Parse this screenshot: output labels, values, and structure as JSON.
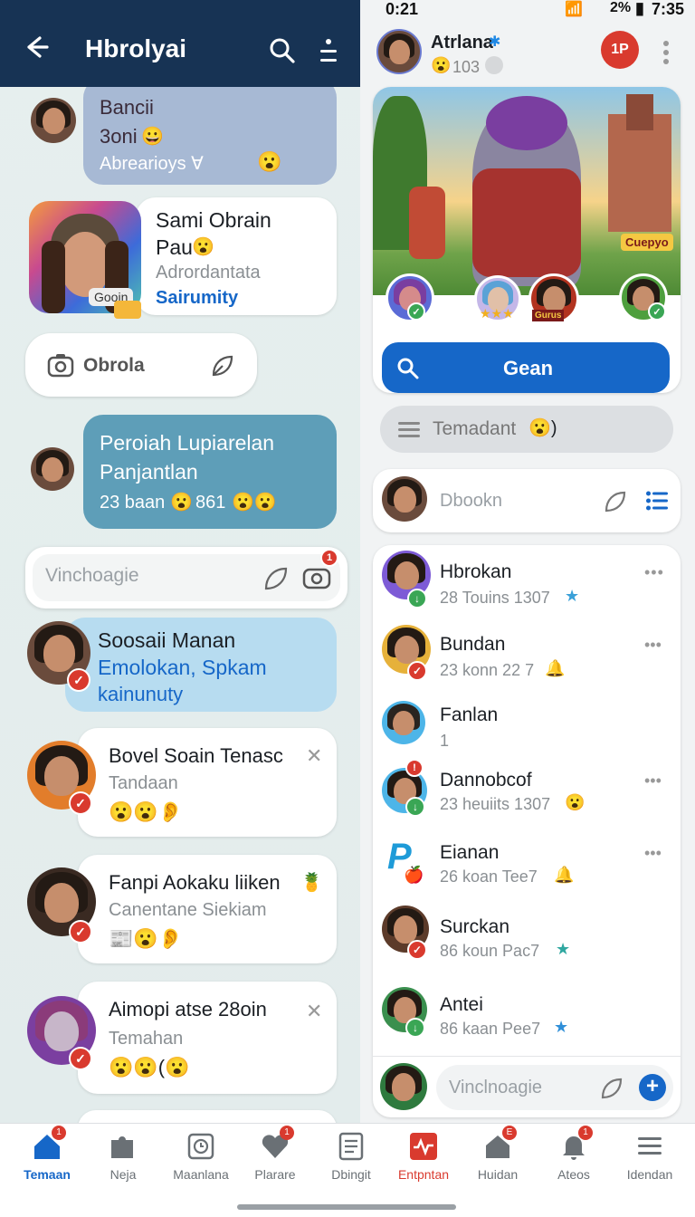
{
  "status_bar": {
    "left_time": "0:21",
    "battery": "2%",
    "right_time": "7:35"
  },
  "left_header": {
    "title": "Hbrolyai"
  },
  "left_chat": {
    "top_bubble": {
      "line1": "Bancii",
      "line2": "3oni",
      "sub": "Abrearioys ∀"
    },
    "profile_card": {
      "name": "Sami Obrain",
      "name2": "Pau",
      "sub": "Adrordantata",
      "link": "Sairumity",
      "badge": "Gooin"
    },
    "input_camera": {
      "label": "Obrola"
    },
    "message": {
      "line1": "Peroiah Lupiarelan",
      "line2": "Panjantlan",
      "stats": "23 baan",
      "stats2": "861"
    },
    "input_main": {
      "placeholder": "Vinchoagie",
      "badge": "1"
    },
    "highlight": {
      "title": "Soosaii Manan",
      "link1": "Emolokan, Spkam",
      "link2": "kainunuty"
    },
    "notifications": [
      {
        "title": "Bovel Soain Tenasc",
        "sub": "Tandaan"
      },
      {
        "title": "Fanpi Aokaku liiken",
        "sub": "Canentane Siekiam"
      },
      {
        "title": "Aimopi atse 28oin",
        "sub": "Temahan"
      }
    ]
  },
  "right_panel": {
    "profile": {
      "name": "Atrlana",
      "count": "103",
      "red_badge": "1P"
    },
    "banner_label": "Cuepyo",
    "mini_label": "Gurus",
    "primary_button": "Gean",
    "filter": {
      "label": "Temadant"
    },
    "search": {
      "label": "Dbookn"
    },
    "contacts": [
      {
        "name": "Hbrokan",
        "sub": "28 Touins 1307"
      },
      {
        "name": "Bundan",
        "sub": "23 konn 22  7"
      },
      {
        "name": "Fanlan",
        "sub": "1"
      },
      {
        "name": "Dannobcof",
        "sub": "23 heuiits 1307"
      },
      {
        "name": "Eianan",
        "sub": "26 koan Tee7"
      },
      {
        "name": "Surckan",
        "sub": "86 koun Pac7"
      },
      {
        "name": "Antei",
        "sub": "86 kaan Pee7"
      }
    ],
    "compose": {
      "placeholder": "Vinclnoagie"
    }
  },
  "nav": [
    {
      "label": "Temaan",
      "icon": "home-icon",
      "badge": "1"
    },
    {
      "label": "Neja",
      "icon": "puzzle-icon",
      "badge": ""
    },
    {
      "label": "Maanlana",
      "icon": "clock-icon",
      "badge": ""
    },
    {
      "label": "Plarare",
      "icon": "heart-icon",
      "badge": "1"
    },
    {
      "label": "Dbingit",
      "icon": "document-icon",
      "badge": ""
    },
    {
      "label": "Entpntan",
      "icon": "activity-icon",
      "badge": ""
    },
    {
      "label": "Huidan",
      "icon": "house-icon",
      "badge": "E"
    },
    {
      "label": "Ateos",
      "icon": "bell-icon",
      "badge": "1"
    },
    {
      "label": "Idendan",
      "icon": "menu-icon",
      "badge": ""
    }
  ],
  "colors": {
    "header": "#173354",
    "accent": "#1667c8",
    "alert": "#d93a2e",
    "active_nav": "#d93a2e"
  }
}
